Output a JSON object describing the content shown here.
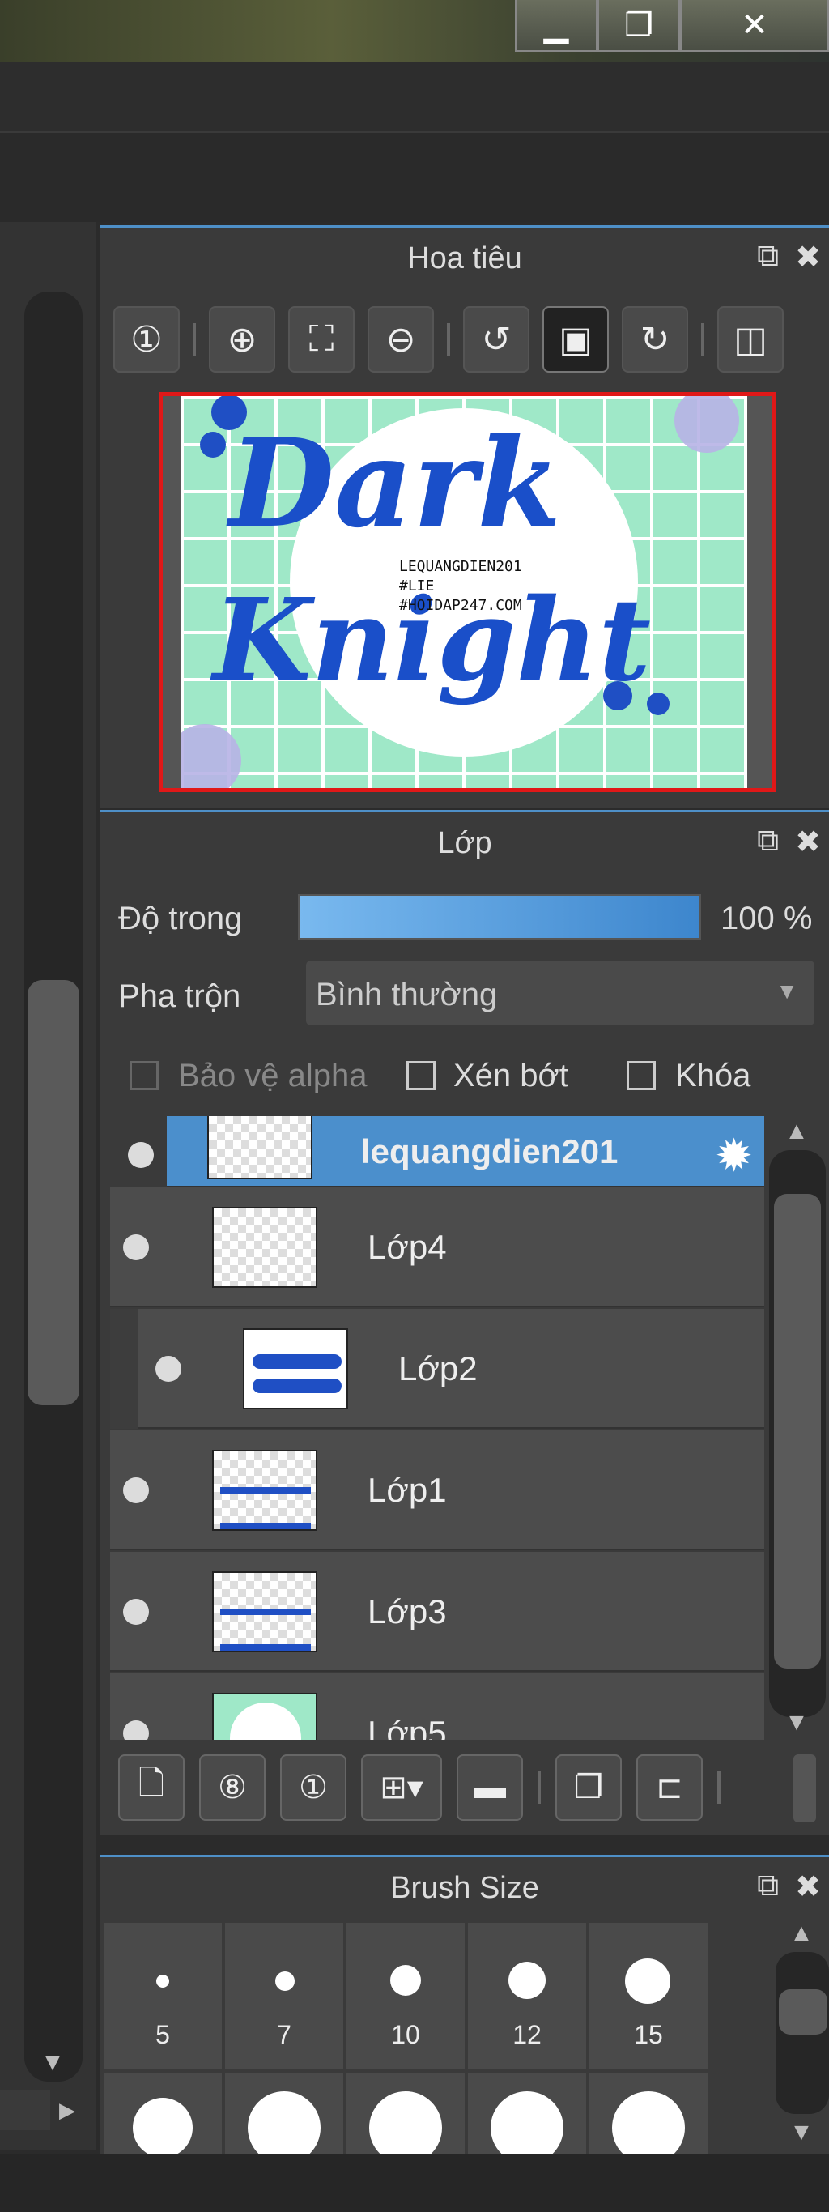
{
  "window": {
    "minimize_glyph": "▁",
    "maximize_glyph": "❐",
    "close_glyph": "✕"
  },
  "navigator": {
    "title": "Hoa tiêu",
    "preview_text": {
      "line1": "Dark",
      "line2": "Knight",
      "credit1": "LEQUANGDIEN201",
      "credit2": "#LIE",
      "credit3": "#HOIDAP247.COM"
    }
  },
  "layers": {
    "title": "Lớp",
    "opacity_label": "Độ trong",
    "opacity_value": "100 %",
    "opacity_fraction": 1.0,
    "blend_label": "Pha trộn",
    "blend_value": "Bình thường",
    "protect_alpha_label": "Bảo vệ alpha",
    "clipping_label": "Xén bớt",
    "lock_label": "Khóa",
    "items": [
      {
        "name": "lequangdien201",
        "selected": true
      },
      {
        "name": "Lớp4",
        "selected": false
      },
      {
        "name": "Lớp2",
        "selected": false
      },
      {
        "name": "Lớp1",
        "selected": false
      },
      {
        "name": "Lớp3",
        "selected": false
      },
      {
        "name": "Lớp5",
        "selected": false
      }
    ]
  },
  "brush": {
    "title": "Brush Size",
    "sizes": [
      "5",
      "7",
      "10",
      "12",
      "15"
    ]
  },
  "colors": {
    "accent": "#4e8fc7",
    "selection": "#4b8fcc",
    "preview_border": "#e01818"
  }
}
